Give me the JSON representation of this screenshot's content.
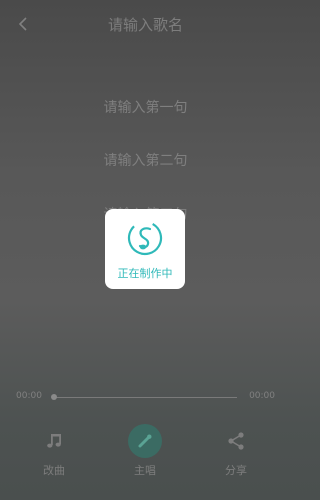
{
  "header": {
    "title": "请输入歌名",
    "back_icon": "chevron-left-icon"
  },
  "lyrics": [
    "请输入第一句",
    "请输入第二句",
    "请输入第三句"
  ],
  "loading": {
    "text": "正在制作中",
    "icon": "music-note-logo-icon",
    "accent_color": "#2fb9b9"
  },
  "player": {
    "current_time": "00:00",
    "total_time": "00:00",
    "progress": 0
  },
  "bottom_bar": {
    "left": {
      "label": "改曲",
      "icon": "music-note-icon"
    },
    "mid": {
      "label": "主唱",
      "icon": "microphone-icon"
    },
    "right": {
      "label": "分享",
      "icon": "share-icon"
    }
  }
}
